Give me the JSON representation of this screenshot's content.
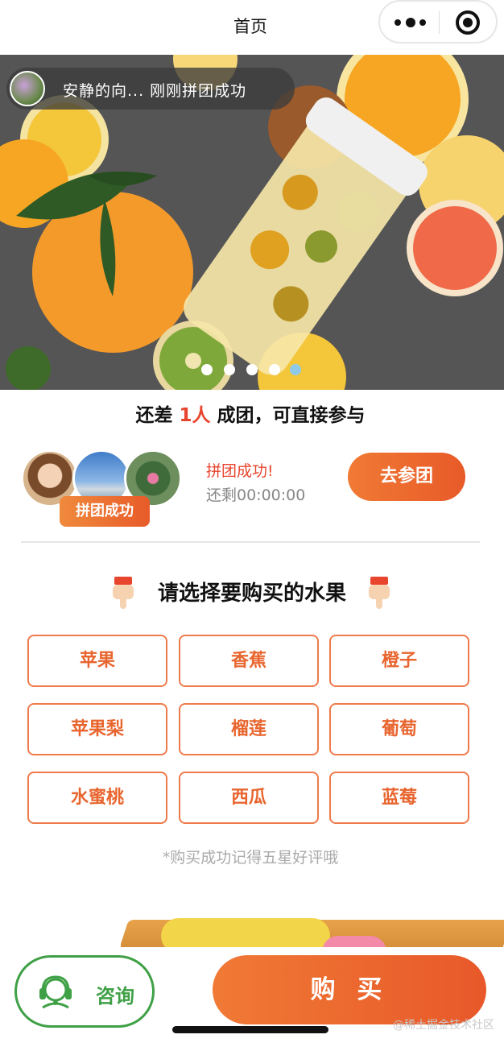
{
  "navbar": {
    "title": "首页"
  },
  "banner": {
    "toast_text": "安静的向... 刚刚拼团成功",
    "slide_count": 5,
    "active_slide": 5
  },
  "group": {
    "prefix": "还差 ",
    "count": "1人",
    "suffix": " 成团，可直接参与",
    "badge": "拼团成功",
    "status_title": "拼团成功!",
    "status_timer": "还剩00:00:00",
    "join_label": "去参团"
  },
  "section": {
    "title": "请选择要购买的水果"
  },
  "fruits": [
    "苹果",
    "香蕉",
    "橙子",
    "苹果梨",
    "榴莲",
    "葡萄",
    "水蜜桃",
    "西瓜",
    "蓝莓"
  ],
  "note": "*购买成功记得五星好评哦",
  "bottom": {
    "consult_label": "咨询",
    "buy_label": "购 买",
    "watermark": "@稀土掘金技术社区"
  },
  "colors": {
    "accent": "#e8652e",
    "price_red": "#e8452e",
    "consult_green": "#3fa046"
  }
}
